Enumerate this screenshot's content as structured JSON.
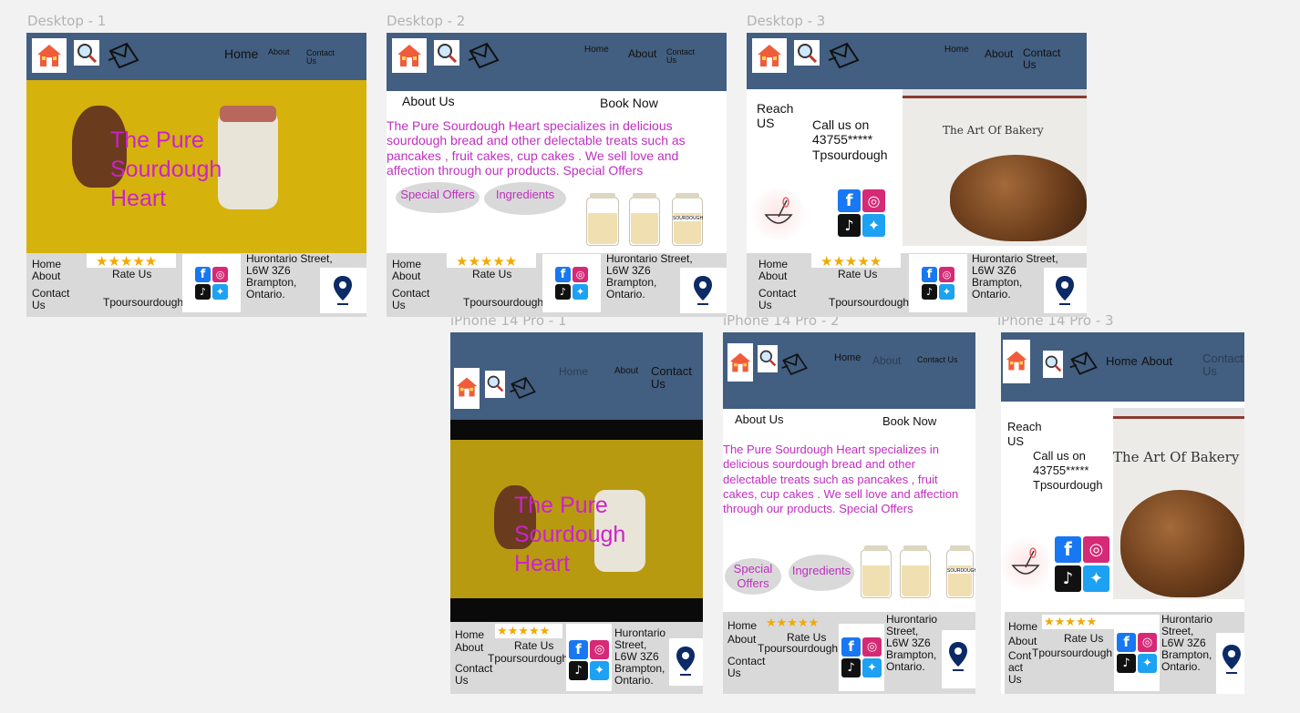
{
  "labels": {
    "d1": "Desktop - 1",
    "d2": "Desktop - 2",
    "d3": "Desktop - 3",
    "p1": "iPhone 14 Pro - 1",
    "p2": "iPhone 14 Pro - 2",
    "p3": "iPhone 14 Pro - 3"
  },
  "nav": {
    "home": "Home",
    "about": "About",
    "contact": "Contact Us"
  },
  "hero": {
    "title": "The Pure Sourdough Heart"
  },
  "tabs": {
    "about": "About Us",
    "book": "Book Now"
  },
  "about_text": "The Pure Sourdough Heart specializes in delicious sourdough bread and other delectable treats such as pancakes , fruit cakes, cup cakes . We sell love and affection through our products. Special Offers",
  "buttons": {
    "special": "Special Offers",
    "ingredients": "Ingredients"
  },
  "jar_label": "SOURDOUGH",
  "contact": {
    "reach": "Reach US",
    "call": "Call us on 43755*****",
    "handle": "Tpsourdough",
    "bakery_title": "The Art Of Bakery"
  },
  "footer": {
    "home": "Home",
    "about": "About",
    "contact": "Contact Us",
    "contact_split": "Cont act Us",
    "rate": "Rate Us",
    "stars": "★★★★★",
    "handle": "Tpoursourdough",
    "address": "Hurontario Street, L6W 3Z6 Brampton, Ontario."
  },
  "icons": {
    "home": "house-icon",
    "search": "magnifier-icon",
    "mail": "envelope-icon",
    "pin": "map-pin-icon",
    "facebook": "facebook-icon",
    "instagram": "instagram-icon",
    "tiktok": "tiktok-icon",
    "twitter": "twitter-icon"
  },
  "colors": {
    "nav": "#425e80",
    "accent": "#c02fc0",
    "hero_title": "#cc22cc",
    "footer": "#d9d9d9",
    "star": "#f2a900",
    "pin": "#0b2a66"
  }
}
